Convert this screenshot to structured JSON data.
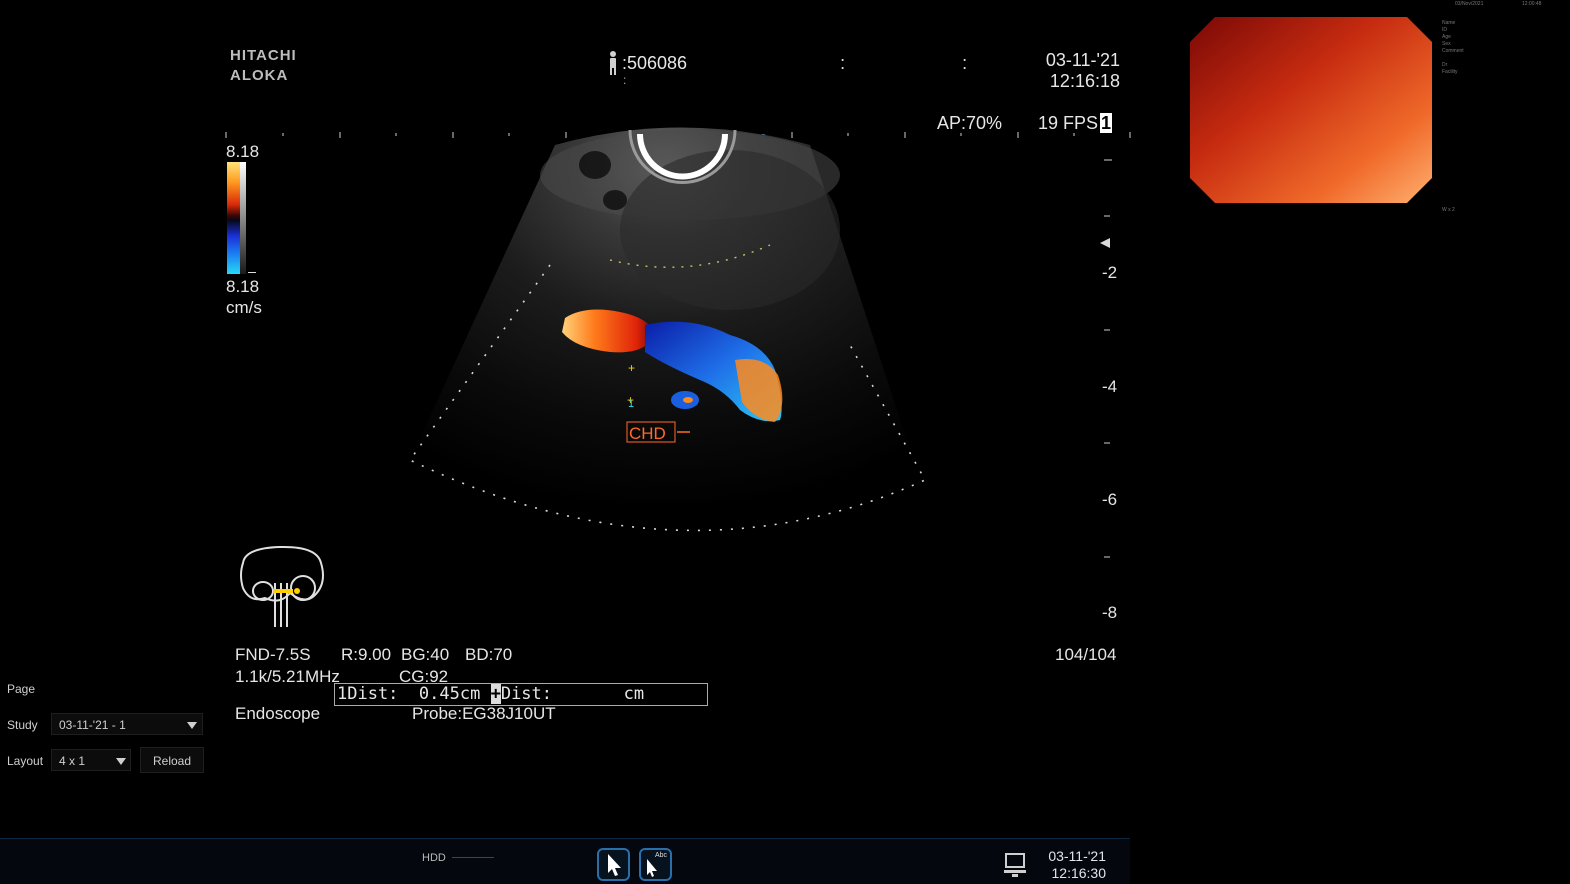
{
  "header": {
    "brand_line1": "HITACHI",
    "brand_line2": "ALOKA",
    "patient_id": ":506086",
    "patient_sep": ":   :",
    "patient_sub": ":",
    "date": "03-11-'21",
    "time": "12:16:18",
    "ap": "AP:70%",
    "fps": "19 FPS",
    "fps_marker": "1"
  },
  "color_scale": {
    "max": "8.18",
    "min": "8.18",
    "unit": "cm/s"
  },
  "depth_scale": {
    "labels": [
      "-2",
      "-4",
      "-6",
      "-8"
    ]
  },
  "image": {
    "structure_label": "CHD",
    "caliper_index": "1"
  },
  "params": {
    "probe_model": "FND-7.5S",
    "r": "R:9.00",
    "bg": "BG:40",
    "bd": "BD:70",
    "freq": "1.1k/5.21MHz",
    "cg": "CG:92",
    "frame": "104/104",
    "mode": "Endoscope",
    "probe": "Probe:EG38J10UT"
  },
  "measurement": {
    "dist1_label": "1Dist:",
    "dist1_value": "0.45cm",
    "dist2_marker": "+",
    "dist2_label": "Dist:",
    "dist2_unit": "cm"
  },
  "sidebar": {
    "page_label": "Page",
    "study_label": "Study",
    "study_value": "03-11-'21 - 1",
    "layout_label": "Layout",
    "layout_value": "4 x 1",
    "reload_label": "Reload"
  },
  "taskbar": {
    "hdd_label": "HDD",
    "text_tool_label": "Abc",
    "date": "03-11-'21",
    "time": "12:16:30",
    "pointer_icon": "pointer-icon",
    "text_pointer_icon": "text-pointer-icon",
    "monitor_icon": "monitor-icon"
  },
  "right_panel": {
    "top_date": "03/Nov/2021",
    "top_time": "12:00:48",
    "fields": [
      "Name",
      "ID",
      "Age",
      "Sex",
      "Comment",
      "",
      "Dr",
      "Facility"
    ],
    "small_note": "W x 2"
  },
  "colors": {
    "background": "#000000",
    "taskbar_accent": "#2a6fa8",
    "label_orange": "#ff6a2b"
  }
}
